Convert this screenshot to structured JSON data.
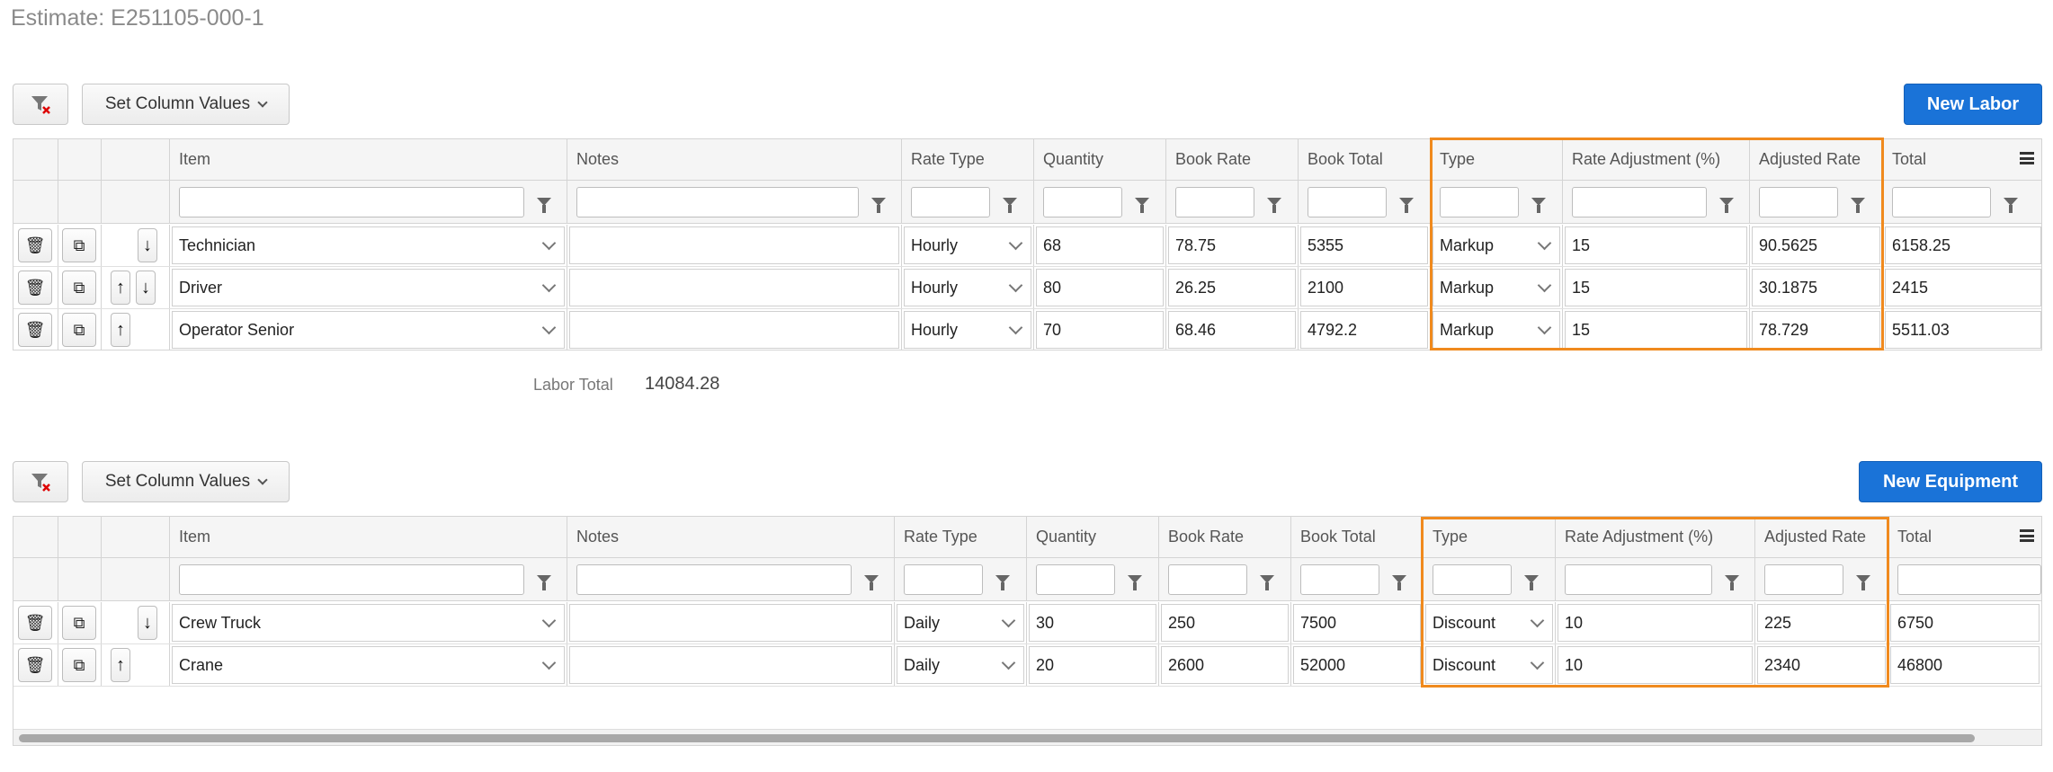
{
  "page": {
    "title": "Estimate: E251105-000-1"
  },
  "labor": {
    "set_column_values": "Set Column Values",
    "new_button": "New Labor",
    "columns": [
      "Item",
      "Notes",
      "Rate Type",
      "Quantity",
      "Book Rate",
      "Book Total",
      "Type",
      "Rate Adjustment (%)",
      "Adjusted Rate",
      "Total"
    ],
    "rows": [
      {
        "item": "Technician",
        "notes": "",
        "rate_type": "Hourly",
        "quantity": "68",
        "book_rate": "78.75",
        "book_total": "5355",
        "type": "Markup",
        "rate_adjustment": "15",
        "adjusted_rate": "90.5625",
        "total": "6158.25"
      },
      {
        "item": "Driver",
        "notes": "",
        "rate_type": "Hourly",
        "quantity": "80",
        "book_rate": "26.25",
        "book_total": "2100",
        "type": "Markup",
        "rate_adjustment": "15",
        "adjusted_rate": "30.1875",
        "total": "2415"
      },
      {
        "item": "Operator Senior",
        "notes": "",
        "rate_type": "Hourly",
        "quantity": "70",
        "book_rate": "68.46",
        "book_total": "4792.2",
        "type": "Markup",
        "rate_adjustment": "15",
        "adjusted_rate": "78.729",
        "total": "5511.03"
      }
    ],
    "total_label": "Labor Total",
    "total_value": "14084.28"
  },
  "equipment": {
    "set_column_values": "Set Column Values",
    "new_button": "New Equipment",
    "columns": [
      "Item",
      "Notes",
      "Rate Type",
      "Quantity",
      "Book Rate",
      "Book Total",
      "Type",
      "Rate Adjustment (%)",
      "Adjusted Rate",
      "Total"
    ],
    "rows": [
      {
        "item": "Crew Truck",
        "notes": "",
        "rate_type": "Daily",
        "quantity": "30",
        "book_rate": "250",
        "book_total": "7500",
        "type": "Discount",
        "rate_adjustment": "10",
        "adjusted_rate": "225",
        "total": "6750"
      },
      {
        "item": "Crane",
        "notes": "",
        "rate_type": "Daily",
        "quantity": "20",
        "book_rate": "2600",
        "book_total": "52000",
        "type": "Discount",
        "rate_adjustment": "10",
        "adjusted_rate": "2340",
        "total": "46800"
      }
    ]
  },
  "icons": {
    "clear_filter": "funnel-x-icon",
    "delete": "trash-icon",
    "copy": "copy-icon",
    "move_up": "arrow-up-icon",
    "move_down": "arrow-down-icon",
    "filter": "funnel-icon",
    "column_menu": "hamburger-icon"
  },
  "colors": {
    "primary": "#1a73d8",
    "highlight": "#f08a1e"
  }
}
